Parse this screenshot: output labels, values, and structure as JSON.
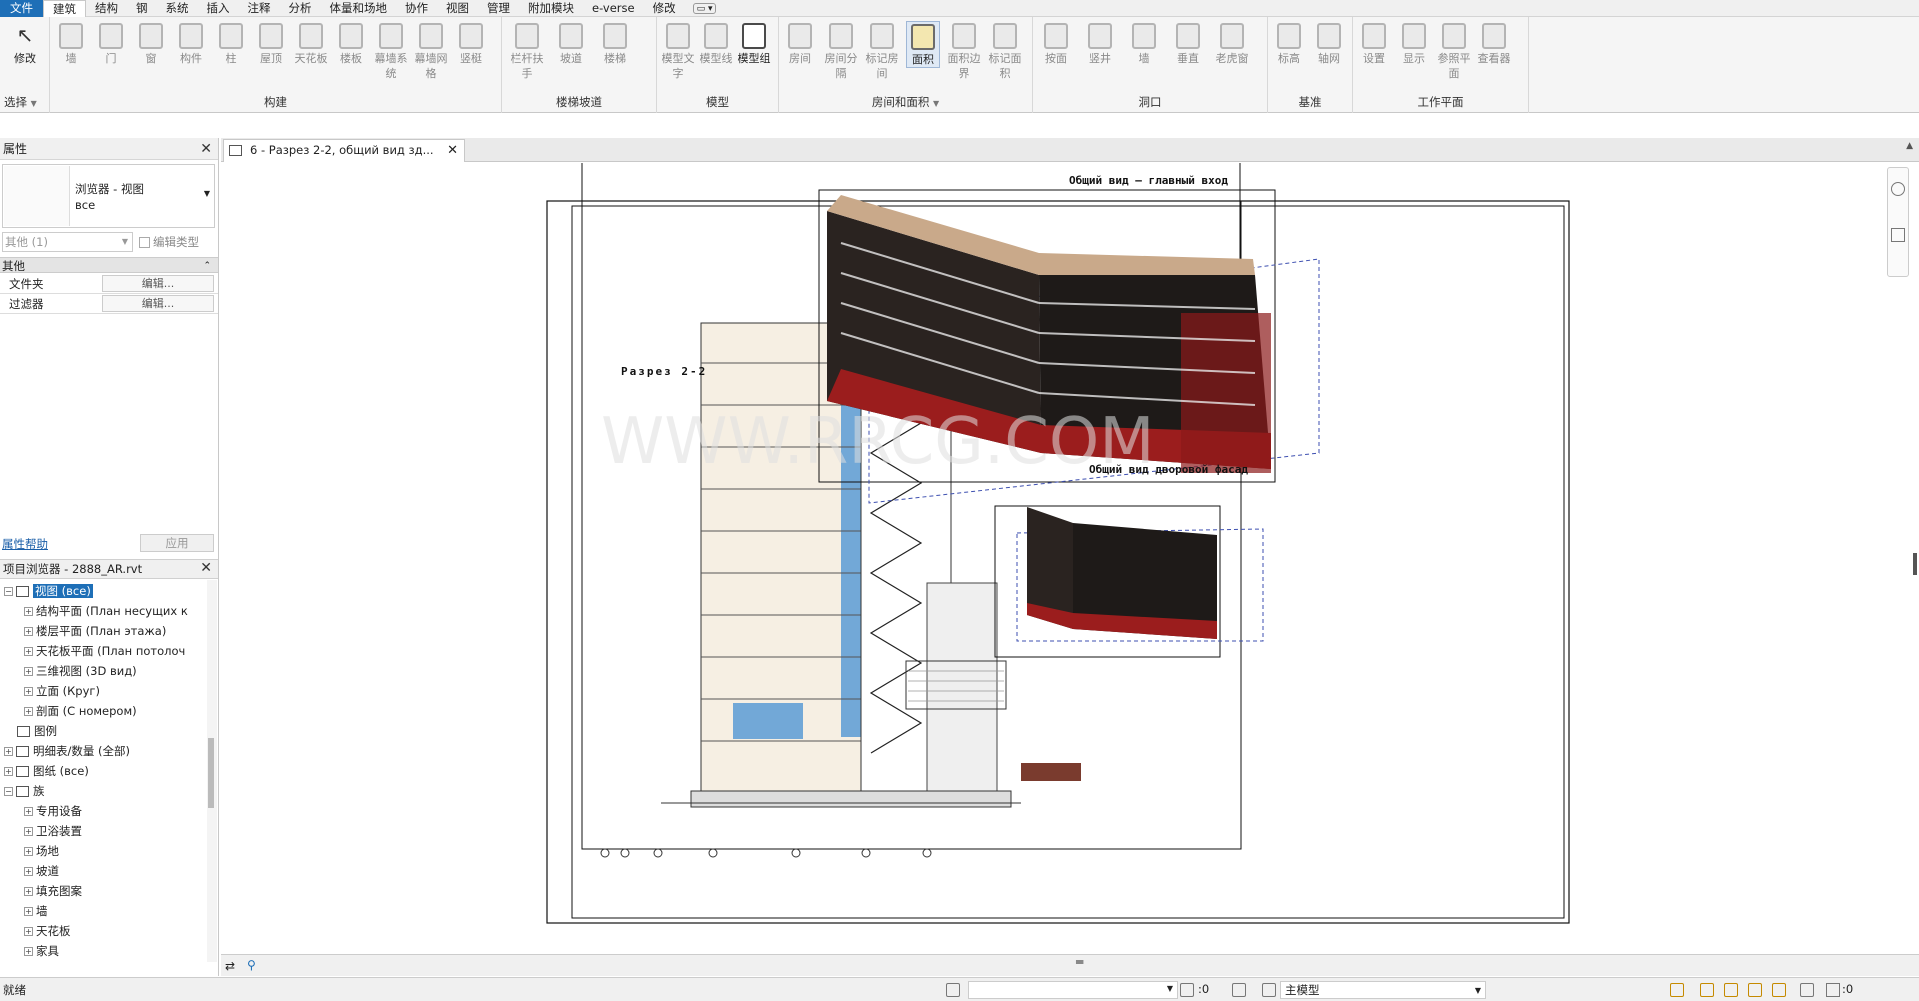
{
  "menu": {
    "tabs": [
      "文件",
      "建筑",
      "结构",
      "钢",
      "系统",
      "插入",
      "注释",
      "分析",
      "体量和场地",
      "协作",
      "视图",
      "管理",
      "附加模块",
      "e-verse",
      "修改"
    ],
    "active_index": 1
  },
  "ribbon": {
    "modify": {
      "label": "修改",
      "select_label": "选择"
    },
    "build": {
      "group_label": "构建",
      "buttons": [
        "墙",
        "门",
        "窗",
        "构件",
        "柱",
        "屋顶",
        "天花板",
        "楼板",
        "幕墙系统",
        "幕墙网格",
        "竖梃"
      ]
    },
    "stairs": {
      "group_label": "楼梯坡道",
      "buttons": [
        "栏杆扶手",
        "坡道",
        "楼梯"
      ]
    },
    "model": {
      "group_label": "模型",
      "buttons": [
        "模型文字",
        "模型线",
        "模型组"
      ]
    },
    "rooms": {
      "group_label": "房间和面积",
      "buttons": [
        "房间",
        "房间分隔",
        "标记房间",
        "面积",
        "面积边界",
        "标记面积"
      ]
    },
    "opening": {
      "group_label": "洞口",
      "buttons": [
        "按面",
        "竖井",
        "墙",
        "垂直",
        "老虎窗"
      ]
    },
    "datum": {
      "group_label": "基准",
      "buttons": [
        "标高",
        "轴网"
      ]
    },
    "workplane": {
      "group_label": "工作平面",
      "buttons": [
        "设置",
        "显示",
        "参照平面",
        "查看器"
      ]
    }
  },
  "properties": {
    "title": "属性",
    "type_name": "浏览器 - 视图",
    "type_sub": "все",
    "instance_filter": "其他 (1)",
    "edit_type": "编辑类型",
    "section": "其他",
    "rows": [
      {
        "label": "文件夹",
        "value": "编辑..."
      },
      {
        "label": "过滤器",
        "value": "编辑..."
      }
    ],
    "help_link": "属性帮助",
    "apply": "应用"
  },
  "browser": {
    "title": "项目浏览器 - 2888_AR.rvt",
    "items": [
      {
        "text": "视图 (все)",
        "level": 0,
        "selected": true,
        "sign": "−"
      },
      {
        "text": "结构平面 (План несущих к",
        "level": 1,
        "sign": "+"
      },
      {
        "text": "楼层平面 (План этажа)",
        "level": 1,
        "sign": "+"
      },
      {
        "text": "天花板平面 (План потолоч",
        "level": 1,
        "sign": "+"
      },
      {
        "text": "三维视图 (3D вид)",
        "level": 1,
        "sign": "+"
      },
      {
        "text": "立面 (Круг)",
        "level": 1,
        "sign": "+"
      },
      {
        "text": "剖面 (С номером)",
        "level": 1,
        "sign": "+"
      },
      {
        "text": "图例",
        "level": 0,
        "sign": ""
      },
      {
        "text": "明细表/数量 (全部)",
        "level": 0,
        "sign": "+"
      },
      {
        "text": "图纸 (все)",
        "level": 0,
        "sign": "+"
      },
      {
        "text": "族",
        "level": 0,
        "sign": "−"
      },
      {
        "text": "专用设备",
        "level": 1,
        "sign": "+"
      },
      {
        "text": "卫浴装置",
        "level": 1,
        "sign": "+"
      },
      {
        "text": "场地",
        "level": 1,
        "sign": "+"
      },
      {
        "text": "坡道",
        "level": 1,
        "sign": "+"
      },
      {
        "text": "填充图案",
        "level": 1,
        "sign": "+"
      },
      {
        "text": "墙",
        "level": 1,
        "sign": "+"
      },
      {
        "text": "天花板",
        "level": 1,
        "sign": "+"
      },
      {
        "text": "家具",
        "level": 1,
        "sign": "+"
      }
    ]
  },
  "document": {
    "tab_title": "6 - Разрез 2-2, общий вид зд...",
    "section_title": "Разрез 2-2",
    "view_main_title": "Общий вид – главный вход",
    "view_yard_title": "Общий вид дворовой фасад",
    "watermark": "WWW.RRCG.COM"
  },
  "status": {
    "text": "就绪",
    "workset_count": ":0",
    "model_label": "主模型",
    "filter_count": ":0"
  },
  "colors": {
    "accent": "#1e6fb7",
    "facade_red": "#9b1d1d",
    "glazing_blue": "#5b9bd5"
  }
}
